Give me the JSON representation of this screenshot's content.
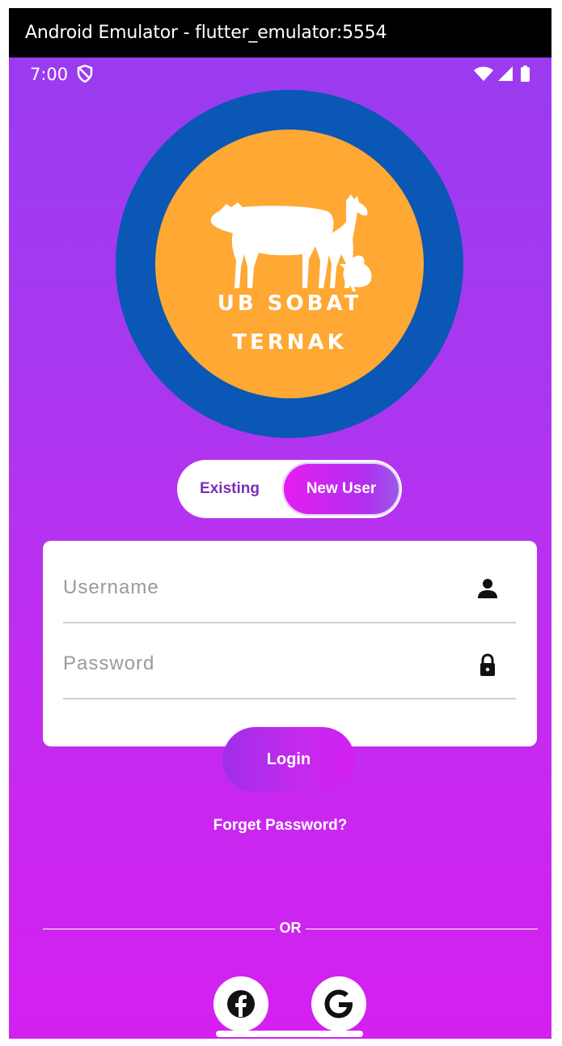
{
  "window": {
    "title": "Android Emulator - flutter_emulator:5554"
  },
  "status_bar": {
    "time": "7:00"
  },
  "logo": {
    "line1": "UB SOBAT",
    "line2": "TERNAK"
  },
  "toggle": {
    "existing_label": "Existing",
    "new_user_label": "New User",
    "selected": "New User"
  },
  "form": {
    "username_placeholder": "Username",
    "password_placeholder": "Password"
  },
  "login_label": "Login",
  "forget_label": "Forget Password?",
  "or_label": "OR",
  "social": {
    "facebook_icon": "facebook-icon",
    "google_icon": "google-icon"
  },
  "colors": {
    "gradient_top": "#9a3bf0",
    "gradient_bottom": "#d420f0",
    "logo_ring": "#0a57b5",
    "logo_fill": "#ffa833",
    "toggle_text": "#7a2fb8"
  }
}
